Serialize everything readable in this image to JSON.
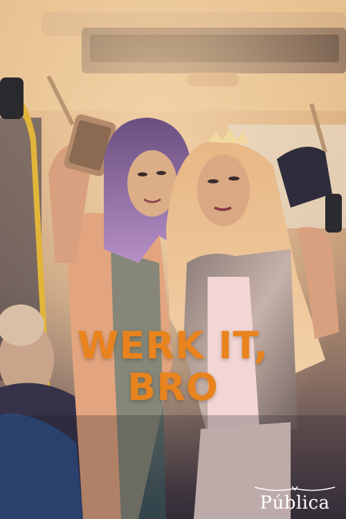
{
  "poster": {
    "title_line_1": "WERK IT,",
    "title_line_2": "BRO",
    "brand": "Pública",
    "title_color": "#e8831d",
    "brand_color": "#ffffff"
  }
}
